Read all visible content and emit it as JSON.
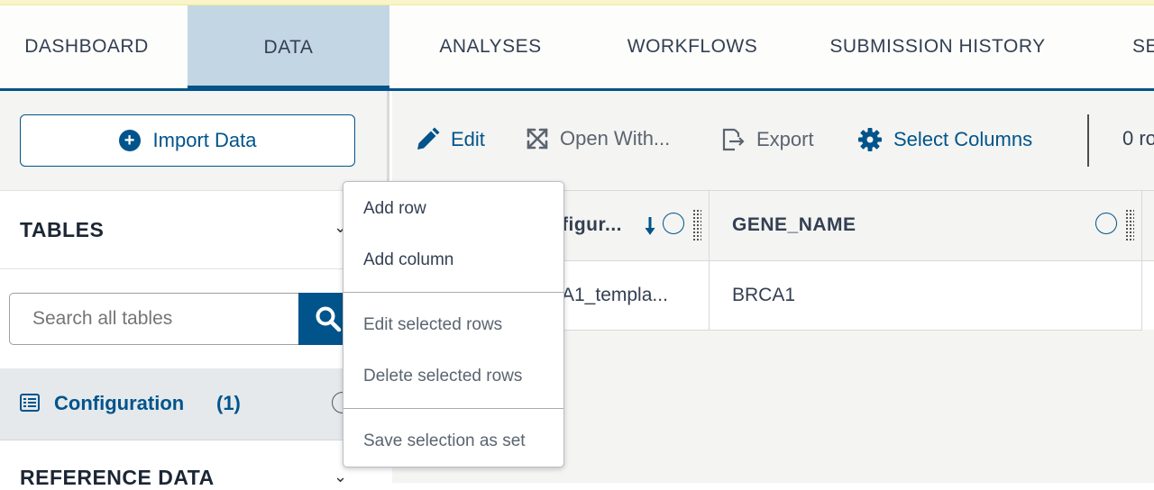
{
  "nav": {
    "tabs": [
      {
        "label": "DASHBOARD"
      },
      {
        "label": "DATA"
      },
      {
        "label": "ANALYSES"
      },
      {
        "label": "WORKFLOWS"
      },
      {
        "label": "SUBMISSION HISTORY"
      },
      {
        "label": "SE"
      }
    ],
    "active_tab": "DATA"
  },
  "sidebar": {
    "import_label": "Import Data",
    "tables_title": "TABLES",
    "search_placeholder": "Search all tables",
    "configuration_label": "Configuration",
    "configuration_count": "(1)",
    "reference_title": "REFERENCE DATA"
  },
  "toolbar": {
    "edit_label": "Edit",
    "open_with_label": "Open With...",
    "export_label": "Export",
    "select_columns_label": "Select Columns",
    "row_count_label": "0 ro"
  },
  "grid": {
    "columns": [
      "figur...",
      "GENE_NAME"
    ],
    "rows": [
      [
        "A1_templa...",
        "BRCA1"
      ]
    ]
  },
  "context_menu": {
    "items": [
      "Add row",
      "Add column",
      "Edit selected rows",
      "Delete selected rows",
      "Save selection as set"
    ]
  },
  "colors": {
    "primary": "#00548b",
    "active_tab_bg": "#c3d6e4"
  }
}
